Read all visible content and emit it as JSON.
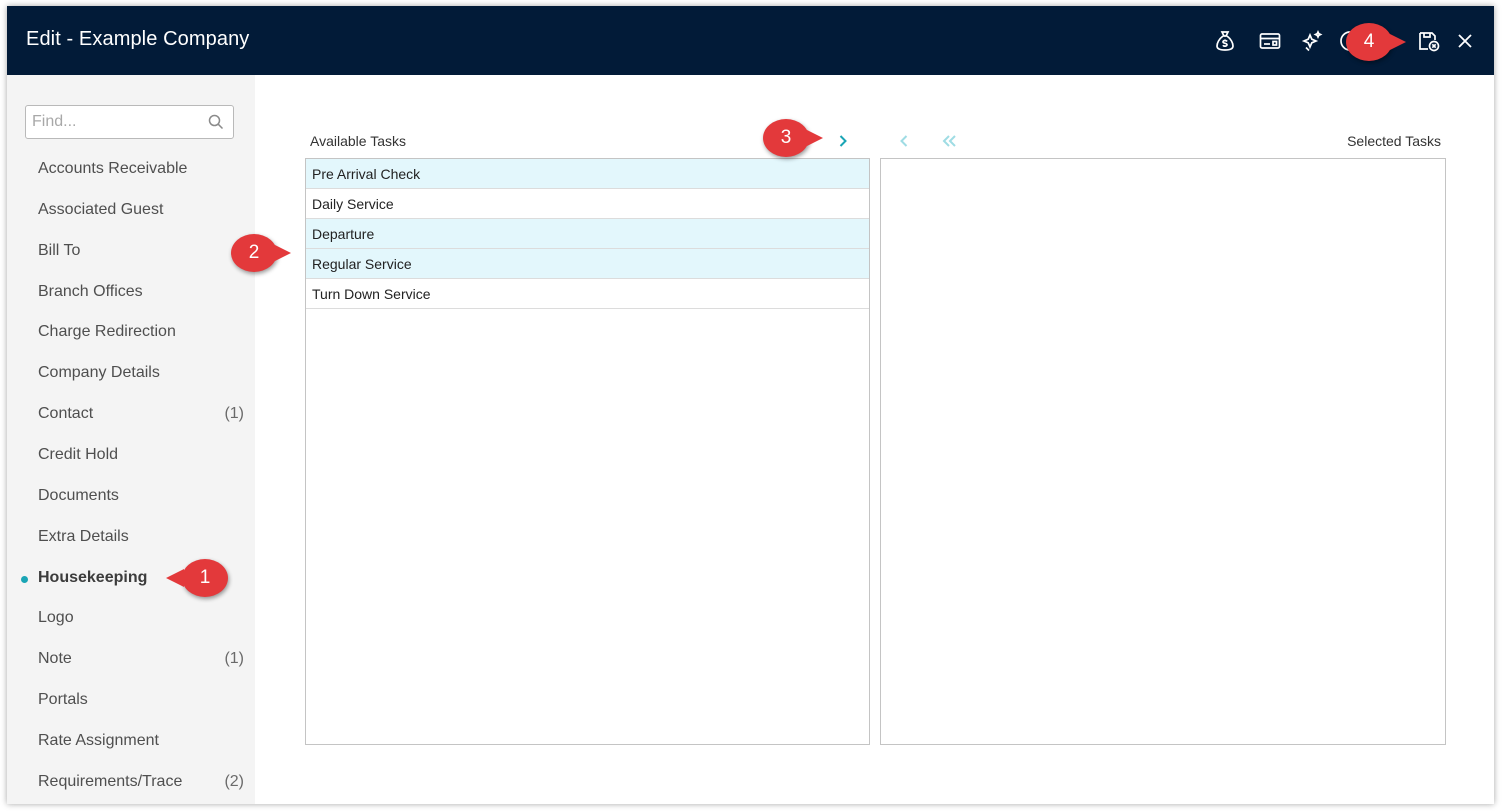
{
  "window": {
    "title": "Edit - Example Company"
  },
  "toolbar_icons": [
    "money-bag-icon",
    "card-icon",
    "sparkle-icon",
    "help-icon",
    "save-close-icon",
    "close-icon"
  ],
  "sidebar": {
    "search_placeholder": "Find...",
    "items": [
      {
        "label": "Accounts Receivable",
        "count": ""
      },
      {
        "label": "Associated Guest",
        "count": ""
      },
      {
        "label": "Bill To",
        "count": ""
      },
      {
        "label": "Branch Offices",
        "count": ""
      },
      {
        "label": "Charge Redirection",
        "count": ""
      },
      {
        "label": "Company Details",
        "count": ""
      },
      {
        "label": "Contact",
        "count": "(1)"
      },
      {
        "label": "Credit Hold",
        "count": ""
      },
      {
        "label": "Documents",
        "count": ""
      },
      {
        "label": "Extra Details",
        "count": ""
      },
      {
        "label": "Housekeeping",
        "count": ""
      },
      {
        "label": "Logo",
        "count": ""
      },
      {
        "label": "Note",
        "count": "(1)"
      },
      {
        "label": "Portals",
        "count": ""
      },
      {
        "label": "Rate Assignment",
        "count": ""
      },
      {
        "label": "Requirements/Trace",
        "count": "(2)"
      }
    ],
    "active_index": 10
  },
  "main": {
    "available_label": "Available Tasks",
    "selected_label": "Selected Tasks",
    "available_tasks": [
      {
        "label": "Pre Arrival Check",
        "selected": true
      },
      {
        "label": "Daily Service",
        "selected": false
      },
      {
        "label": "Departure",
        "selected": true
      },
      {
        "label": "Regular Service",
        "selected": true
      },
      {
        "label": "Turn Down Service",
        "selected": false
      }
    ],
    "selected_tasks": []
  },
  "callouts": [
    "1",
    "2",
    "3",
    "4"
  ],
  "colors": {
    "titlebar": "#021b38",
    "accent": "#1aa5b5",
    "selected_row": "#e3f7fc",
    "callout": "#e3393b"
  }
}
